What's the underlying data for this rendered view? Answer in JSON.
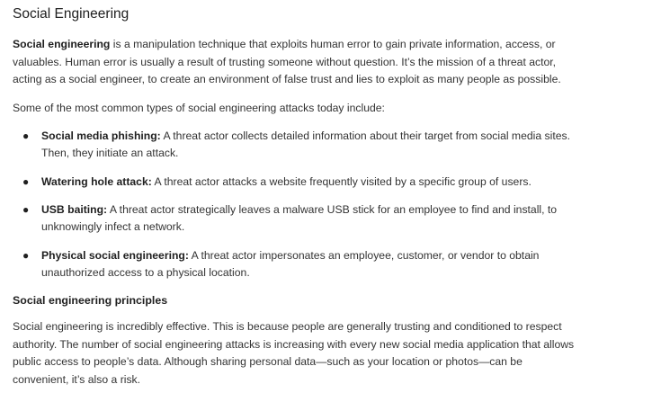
{
  "title": "Social Engineering",
  "intro": {
    "term": "Social engineering",
    "text": " is a manipulation technique that exploits human error to gain private information, access, or valuables. Human error is usually a result of trusting someone without question. It’s the mission of a threat actor, acting as a social engineer, to create an environment of false trust and lies to exploit as many people as possible."
  },
  "list_intro": "Some of the most common types of social engineering attacks today include:",
  "attacks": [
    {
      "term": "Social media phishing:",
      "text": " A threat actor collects detailed information about their target from social media sites. Then, they initiate an attack."
    },
    {
      "term": "Watering hole attack:",
      "text": " A threat actor attacks a website frequently visited by a specific group of users."
    },
    {
      "term": "USB baiting:",
      "text": " A threat actor strategically leaves a malware USB stick for an employee to find and install, to unknowingly infect a network."
    },
    {
      "term": "Physical social engineering:",
      "text": " A threat actor impersonates an employee, customer, or vendor to obtain unauthorized access to a physical location."
    }
  ],
  "principles": {
    "heading": "Social engineering principles",
    "text": "Social engineering is incredibly effective. This is because people are generally trusting and conditioned to respect authority. The number of social engineering attacks is increasing with every new social media application that allows public access to people’s data. Although sharing personal data—such as your location or photos—can be convenient, it’s also a risk."
  }
}
